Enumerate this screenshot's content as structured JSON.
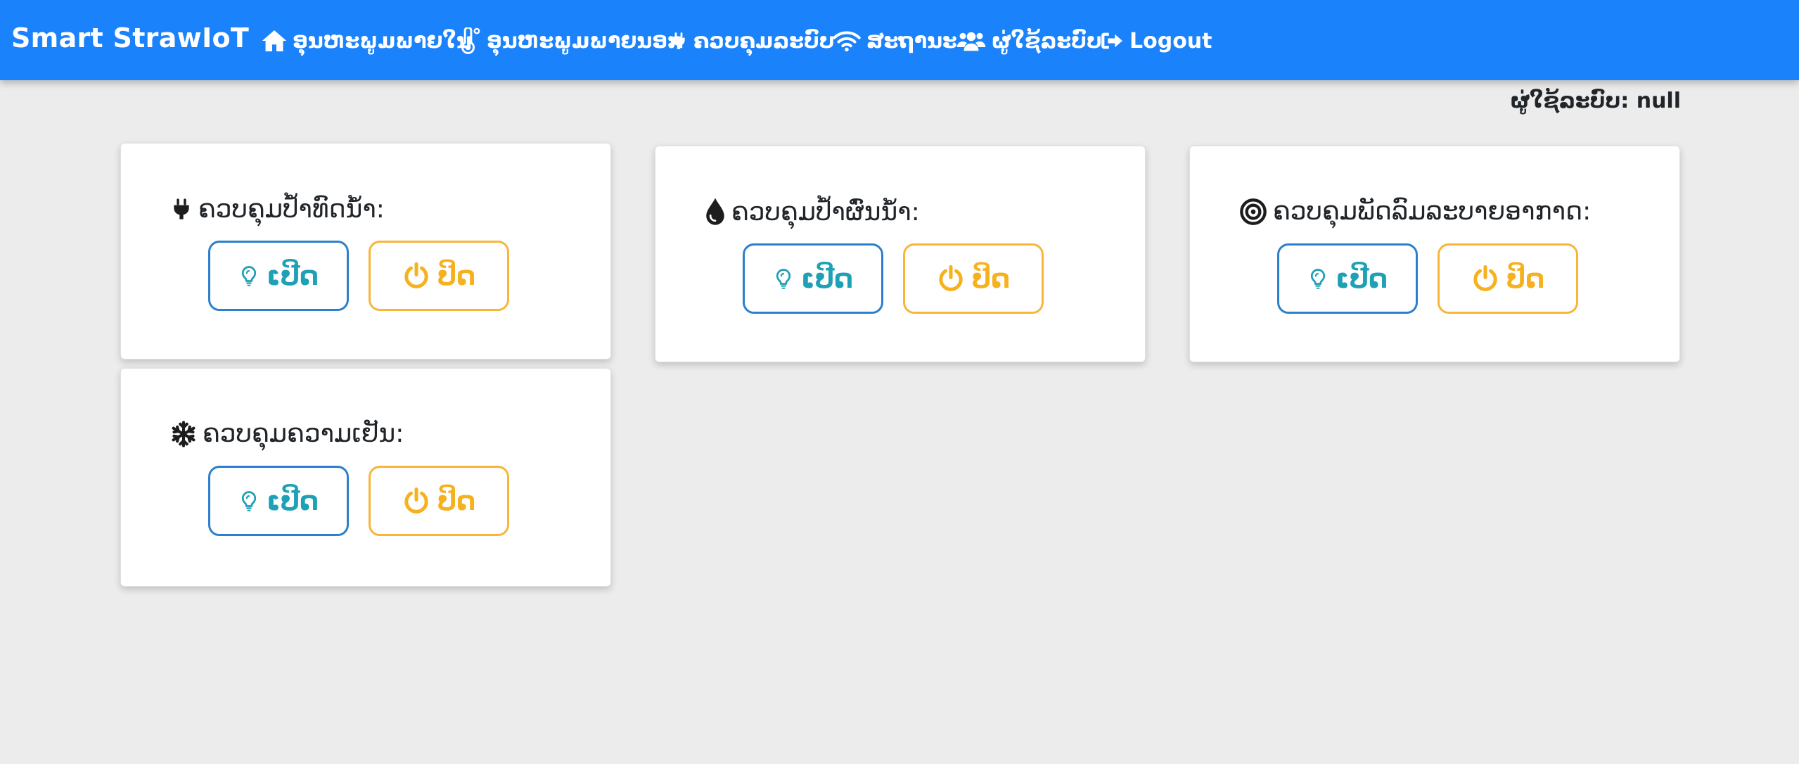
{
  "navbar": {
    "brand": "Smart StrawIoT",
    "items": [
      {
        "label": "ອຸນຫະພູມພາຍໃນ",
        "icon": "home-icon"
      },
      {
        "label": "ອຸນຫະພູມພາຍນອກ",
        "icon": "thermometer-icon"
      },
      {
        "label": "ຄວບຄຸມລະບົບ",
        "icon": "plug-icon"
      },
      {
        "label": "ສະຖານະ",
        "icon": "wifi-icon"
      },
      {
        "label": "ຜູ່ໃຊ້ລະບົບ",
        "icon": "users-icon"
      },
      {
        "label": "Logout",
        "icon": "sign-out-icon"
      }
    ]
  },
  "user": {
    "text": "ຜູ່ໃຊ້ລະບົບ: null"
  },
  "controls": [
    {
      "title": "ຄວບຄຸມປ້ຳທົດນ້ຳ:",
      "icon": "plug-icon",
      "on_label": "ເປີດ",
      "off_label": "ປິດ"
    },
    {
      "title": "ຄວບຄຸມປ້ຳຜົ່ນນ້ຳ:",
      "icon": "tint-icon",
      "on_label": "ເປີດ",
      "off_label": "ປິດ"
    },
    {
      "title": "ຄວບຄຸມພັດລົມລະບາຍອາກາດ:",
      "icon": "bullseye-icon",
      "on_label": "ເປີດ",
      "off_label": "ປິດ"
    },
    {
      "title": "ຄວບຄຸມຄວາມເຢັນ:",
      "icon": "snowflake-icon",
      "on_label": "ເປີດ",
      "off_label": "ປິດ"
    }
  ],
  "colors": {
    "navbar": "#1a82fb",
    "background": "#ececec",
    "on_border": "#2b80cd",
    "on_text": "#1ea0b5",
    "off": "#f6b11f"
  }
}
